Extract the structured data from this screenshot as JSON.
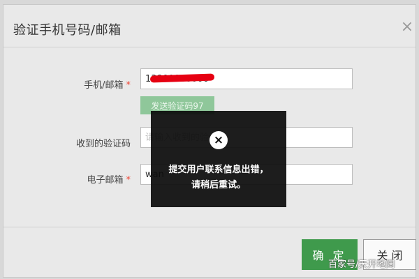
{
  "dialog": {
    "title": "验证手机号码/邮箱",
    "close_icon": "×"
  },
  "form": {
    "phone_label": "手机/邮箱",
    "phone_required": "*",
    "phone_value": "13800000000",
    "send_code_label": "发送验证码97",
    "code_label": "收到的验证码",
    "code_placeholder": "请输入收到的验证码",
    "email_label": "电子邮箱",
    "email_required": "*",
    "email_value": "wan"
  },
  "toast": {
    "icon": "×",
    "message": "提交用户联系信息出错，请稍后重试。"
  },
  "footer": {
    "ok_label": "确 定",
    "close_label": "关 闭"
  },
  "watermark": {
    "text": "百家号/天开地阔"
  },
  "colors": {
    "accent": "#3f9a4c",
    "send_code_bg": "#8fc79a",
    "required": "#ee4433",
    "toast_bg": "#0c0c0c"
  }
}
